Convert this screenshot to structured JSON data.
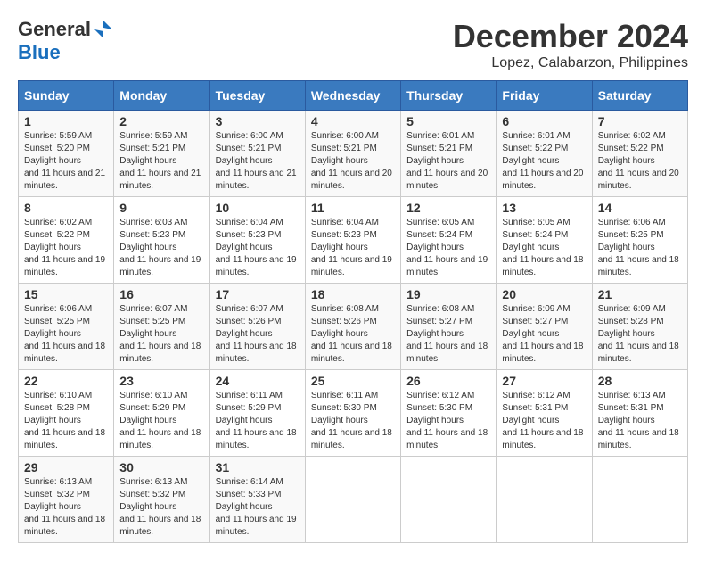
{
  "logo": {
    "general": "General",
    "blue": "Blue"
  },
  "title": "December 2024",
  "location": "Lopez, Calabarzon, Philippines",
  "days_of_week": [
    "Sunday",
    "Monday",
    "Tuesday",
    "Wednesday",
    "Thursday",
    "Friday",
    "Saturday"
  ],
  "weeks": [
    [
      {
        "day": "1",
        "sunrise": "5:59 AM",
        "sunset": "5:20 PM",
        "daylight": "11 hours and 21 minutes."
      },
      {
        "day": "2",
        "sunrise": "5:59 AM",
        "sunset": "5:21 PM",
        "daylight": "11 hours and 21 minutes."
      },
      {
        "day": "3",
        "sunrise": "6:00 AM",
        "sunset": "5:21 PM",
        "daylight": "11 hours and 21 minutes."
      },
      {
        "day": "4",
        "sunrise": "6:00 AM",
        "sunset": "5:21 PM",
        "daylight": "11 hours and 20 minutes."
      },
      {
        "day": "5",
        "sunrise": "6:01 AM",
        "sunset": "5:21 PM",
        "daylight": "11 hours and 20 minutes."
      },
      {
        "day": "6",
        "sunrise": "6:01 AM",
        "sunset": "5:22 PM",
        "daylight": "11 hours and 20 minutes."
      },
      {
        "day": "7",
        "sunrise": "6:02 AM",
        "sunset": "5:22 PM",
        "daylight": "11 hours and 20 minutes."
      }
    ],
    [
      {
        "day": "8",
        "sunrise": "6:02 AM",
        "sunset": "5:22 PM",
        "daylight": "11 hours and 19 minutes."
      },
      {
        "day": "9",
        "sunrise": "6:03 AM",
        "sunset": "5:23 PM",
        "daylight": "11 hours and 19 minutes."
      },
      {
        "day": "10",
        "sunrise": "6:04 AM",
        "sunset": "5:23 PM",
        "daylight": "11 hours and 19 minutes."
      },
      {
        "day": "11",
        "sunrise": "6:04 AM",
        "sunset": "5:23 PM",
        "daylight": "11 hours and 19 minutes."
      },
      {
        "day": "12",
        "sunrise": "6:05 AM",
        "sunset": "5:24 PM",
        "daylight": "11 hours and 19 minutes."
      },
      {
        "day": "13",
        "sunrise": "6:05 AM",
        "sunset": "5:24 PM",
        "daylight": "11 hours and 18 minutes."
      },
      {
        "day": "14",
        "sunrise": "6:06 AM",
        "sunset": "5:25 PM",
        "daylight": "11 hours and 18 minutes."
      }
    ],
    [
      {
        "day": "15",
        "sunrise": "6:06 AM",
        "sunset": "5:25 PM",
        "daylight": "11 hours and 18 minutes."
      },
      {
        "day": "16",
        "sunrise": "6:07 AM",
        "sunset": "5:25 PM",
        "daylight": "11 hours and 18 minutes."
      },
      {
        "day": "17",
        "sunrise": "6:07 AM",
        "sunset": "5:26 PM",
        "daylight": "11 hours and 18 minutes."
      },
      {
        "day": "18",
        "sunrise": "6:08 AM",
        "sunset": "5:26 PM",
        "daylight": "11 hours and 18 minutes."
      },
      {
        "day": "19",
        "sunrise": "6:08 AM",
        "sunset": "5:27 PM",
        "daylight": "11 hours and 18 minutes."
      },
      {
        "day": "20",
        "sunrise": "6:09 AM",
        "sunset": "5:27 PM",
        "daylight": "11 hours and 18 minutes."
      },
      {
        "day": "21",
        "sunrise": "6:09 AM",
        "sunset": "5:28 PM",
        "daylight": "11 hours and 18 minutes."
      }
    ],
    [
      {
        "day": "22",
        "sunrise": "6:10 AM",
        "sunset": "5:28 PM",
        "daylight": "11 hours and 18 minutes."
      },
      {
        "day": "23",
        "sunrise": "6:10 AM",
        "sunset": "5:29 PM",
        "daylight": "11 hours and 18 minutes."
      },
      {
        "day": "24",
        "sunrise": "6:11 AM",
        "sunset": "5:29 PM",
        "daylight": "11 hours and 18 minutes."
      },
      {
        "day": "25",
        "sunrise": "6:11 AM",
        "sunset": "5:30 PM",
        "daylight": "11 hours and 18 minutes."
      },
      {
        "day": "26",
        "sunrise": "6:12 AM",
        "sunset": "5:30 PM",
        "daylight": "11 hours and 18 minutes."
      },
      {
        "day": "27",
        "sunrise": "6:12 AM",
        "sunset": "5:31 PM",
        "daylight": "11 hours and 18 minutes."
      },
      {
        "day": "28",
        "sunrise": "6:13 AM",
        "sunset": "5:31 PM",
        "daylight": "11 hours and 18 minutes."
      }
    ],
    [
      {
        "day": "29",
        "sunrise": "6:13 AM",
        "sunset": "5:32 PM",
        "daylight": "11 hours and 18 minutes."
      },
      {
        "day": "30",
        "sunrise": "6:13 AM",
        "sunset": "5:32 PM",
        "daylight": "11 hours and 18 minutes."
      },
      {
        "day": "31",
        "sunrise": "6:14 AM",
        "sunset": "5:33 PM",
        "daylight": "11 hours and 19 minutes."
      },
      null,
      null,
      null,
      null
    ]
  ]
}
